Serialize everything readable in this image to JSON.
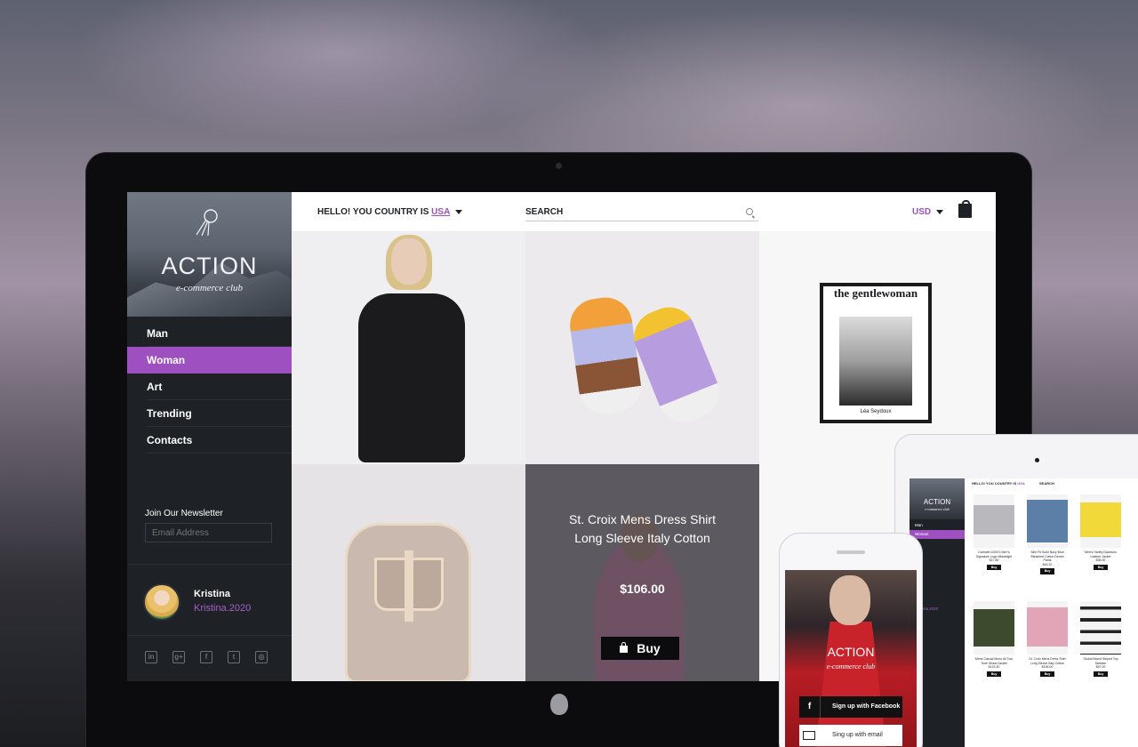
{
  "brand": {
    "name": "ACTION",
    "tagline": "e-commerce club"
  },
  "nav": {
    "items": [
      {
        "label": "Man",
        "active": false
      },
      {
        "label": "Woman",
        "active": true
      },
      {
        "label": "Art",
        "active": false
      },
      {
        "label": "Trending",
        "active": false
      },
      {
        "label": "Contacts",
        "active": false
      }
    ]
  },
  "newsletter": {
    "label": "Join Our Newsletter",
    "placeholder": "Email Address"
  },
  "user": {
    "name": "Kristina",
    "handle": "Kristina.2020"
  },
  "social_icons": [
    "linkedin-icon",
    "google-plus-icon",
    "facebook-icon",
    "twitter-icon",
    "instagram-icon"
  ],
  "topbar": {
    "country_prefix": "HELLO! YOU COUNTRY IS ",
    "country": "USA",
    "search": "SEARCH",
    "currency": "USD"
  },
  "tiles": {
    "magazine": {
      "title": "the gentlewoman",
      "name": "Léa Seydoux"
    },
    "featured": {
      "title_line1": "St. Croix Mens Dress Shirt",
      "title_line2": "Long Sleeve Italy Cotton",
      "price": "$106.00",
      "buy_label": "Buy"
    }
  },
  "tablet": {
    "brand": "ACTION",
    "tagline": "e-commerce club",
    "nav": [
      "Man",
      "Woman"
    ],
    "country_prefix": "HELLO! YOU COUNTRY IS ",
    "country": "USA",
    "search": "SEARCH",
    "user_handle": "Kristina.2020",
    "products": [
      {
        "name": "Carhartt 100074 Men's Signature Logo Midweight",
        "price": "$17.80",
        "buy": "Buy"
      },
      {
        "name": "Slim Fit Solid Navy Blue Bleached Cotton Denim Pants",
        "price": "$49.20",
        "buy": "Buy"
      },
      {
        "name": "Men's Harley Davidson Leather Jacket",
        "price": "$35.00",
        "buy": "Buy"
      },
      {
        "name": "Mens Casual Mono All Two Tone Shawl Jacket",
        "price": "$123.30",
        "buy": "Buy"
      },
      {
        "name": "St. Croix Mens Dress Shirt Long Sleeve Italy Cotton",
        "price": "$106.00",
        "buy": "Buy"
      },
      {
        "name": "Global Brand Striped Top Sweater",
        "price": "$57.00",
        "buy": "Buy"
      }
    ]
  },
  "phone": {
    "brand": "ACTION",
    "tagline": "e-commerce club",
    "facebook_label": "Sign up with Facebook",
    "email_label": "Sing up with email"
  },
  "colors": {
    "accent": "#9e4fc0",
    "sidebar": "#1e2126"
  }
}
